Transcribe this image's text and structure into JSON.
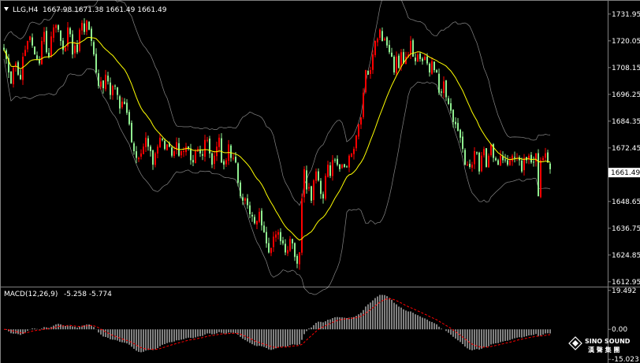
{
  "header": {
    "symbol": "LLG,H4",
    "ohlc": "1667.98 1671.38 1661.49 1661.49"
  },
  "macd_header": {
    "name": "MACD(12,26,9)",
    "values": "-5.258 -5.774"
  },
  "last_price_label": "1661.49",
  "logo": {
    "line1": "SINO SOUND",
    "line2": "漢 聲 集 團"
  },
  "colors": {
    "background": "#000000",
    "bull": "#ff0000",
    "bear": "#90ee90",
    "ma": "#ffff00",
    "bands": "#c0c0c0",
    "macd_hist": "#ffffff",
    "macd_signal": "#ff0000"
  },
  "chart_data": [
    {
      "type": "candlestick",
      "name": "main",
      "y_ticks": [
        1731.95,
        1720.05,
        1708.15,
        1696.25,
        1684.35,
        1672.45,
        1660.55,
        1648.65,
        1636.75,
        1624.85,
        1612.95
      ],
      "y_tick_labels": [
        "1731.95",
        "1720.05",
        "1708.15",
        "1696.25",
        "1684.35",
        "1672.45",
        "1661.49",
        "1648.65",
        "1636.75",
        "1624.85",
        "1612.95"
      ],
      "ylim": [
        1611.5,
        1737.5
      ],
      "last_price": 1661.49,
      "closes": [
        1716,
        1712,
        1706,
        1701,
        1708,
        1710,
        1705,
        1703,
        1713,
        1716,
        1720,
        1722,
        1718,
        1714,
        1712,
        1710,
        1720,
        1724,
        1715,
        1713,
        1722,
        1726,
        1727,
        1725,
        1720,
        1716,
        1717,
        1726,
        1723,
        1714,
        1718,
        1715,
        1725,
        1728,
        1724,
        1729,
        1725,
        1720,
        1714,
        1706,
        1700,
        1702,
        1699,
        1705,
        1702,
        1696,
        1700,
        1700,
        1696,
        1690,
        1693,
        1692,
        1688,
        1683,
        1675,
        1671,
        1668,
        1668,
        1670,
        1673,
        1677,
        1673,
        1671,
        1665,
        1670,
        1673,
        1677,
        1676,
        1672,
        1674,
        1673,
        1669,
        1671,
        1675,
        1669,
        1671,
        1671,
        1673,
        1672,
        1667,
        1666,
        1671,
        1672,
        1670,
        1669,
        1676,
        1676,
        1670,
        1665,
        1669,
        1673,
        1677,
        1666,
        1665,
        1667,
        1674,
        1668,
        1668,
        1666,
        1657,
        1651,
        1649,
        1650,
        1647,
        1643,
        1642,
        1639,
        1640,
        1644,
        1638,
        1635,
        1630,
        1626,
        1628,
        1633,
        1634,
        1635,
        1631,
        1630,
        1626,
        1627,
        1632,
        1630,
        1624,
        1621,
        1626,
        1650,
        1663,
        1654,
        1655,
        1649,
        1658,
        1662,
        1658,
        1652,
        1650,
        1660,
        1665,
        1660,
        1667,
        1667,
        1665,
        1663,
        1665,
        1664,
        1664,
        1669,
        1670,
        1672,
        1678,
        1683,
        1686,
        1697,
        1707,
        1705,
        1707,
        1714,
        1720,
        1721,
        1725,
        1720,
        1721,
        1718,
        1715,
        1713,
        1706,
        1713,
        1708,
        1715,
        1710,
        1713,
        1714,
        1720,
        1713,
        1711,
        1714,
        1712,
        1711,
        1713,
        1710,
        1706,
        1711,
        1707,
        1706,
        1697,
        1697,
        1702,
        1695,
        1692,
        1689,
        1684,
        1683,
        1680,
        1677,
        1672,
        1665,
        1665,
        1664,
        1665,
        1671,
        1670,
        1662,
        1669,
        1672,
        1664,
        1669,
        1674,
        1668,
        1667,
        1665,
        1669,
        1667,
        1667,
        1665,
        1667,
        1669,
        1668,
        1668,
        1667,
        1662,
        1668,
        1667,
        1669,
        1666,
        1666,
        1670,
        1651,
        1667,
        1668,
        1670,
        1666,
        1663
      ],
      "overlays": [
        {
          "name": "moving-average",
          "color": "#ffff00"
        },
        {
          "name": "bollinger-bands",
          "color": "#c0c0c0",
          "k": 2
        }
      ]
    },
    {
      "type": "bar+line",
      "name": "macd",
      "y_ticks": [
        19.492,
        0.0,
        -15.023
      ],
      "y_tick_labels": [
        "19.492",
        "0.00",
        "-15.023"
      ],
      "ylim": [
        -15.7,
        20.6
      ],
      "histogram_color": "#ffffff",
      "signal_color": "#ff0000"
    }
  ]
}
